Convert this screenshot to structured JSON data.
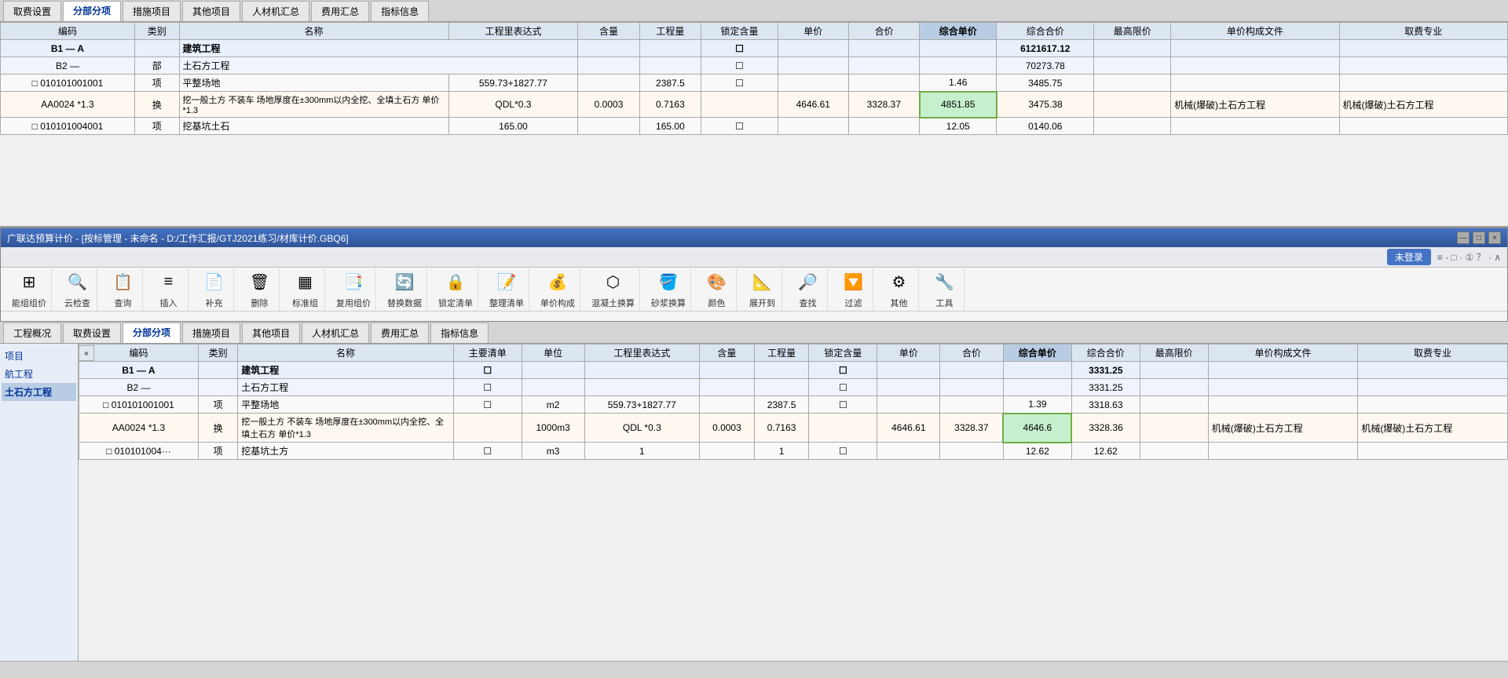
{
  "topWindow": {
    "tabs": [
      {
        "label": "取费设置",
        "active": false
      },
      {
        "label": "分部分项",
        "active": true
      },
      {
        "label": "措施项目",
        "active": false
      },
      {
        "label": "其他项目",
        "active": false
      },
      {
        "label": "人材机汇总",
        "active": false
      },
      {
        "label": "费用汇总",
        "active": false
      },
      {
        "label": "指标信息",
        "active": false
      }
    ],
    "columns": [
      {
        "label": "编码"
      },
      {
        "label": "类别"
      },
      {
        "label": "名称"
      },
      {
        "label": "工程里表达式"
      },
      {
        "label": "含量"
      },
      {
        "label": "工程量"
      },
      {
        "label": "锁定含量"
      },
      {
        "label": "单价"
      },
      {
        "label": "合价"
      },
      {
        "label": "综合单价"
      },
      {
        "label": "综合合价"
      },
      {
        "label": "最高限价"
      },
      {
        "label": "单价构成文件"
      },
      {
        "label": "取费专业"
      }
    ],
    "rows": [
      {
        "id": "B1",
        "type": "",
        "code": "A",
        "name": "建筑工程",
        "expr": "",
        "hl": "",
        "qty": "",
        "lock": "",
        "dj": "",
        "hj": "",
        "zhDj": "",
        "zhHj": "6121617.12",
        "max": "",
        "file": "",
        "fee": "",
        "isB1": true
      },
      {
        "id": "B2",
        "type": "部",
        "code": "",
        "name": "土石方工程",
        "expr": "",
        "hl": "",
        "qty": "",
        "lock": "",
        "dj": "",
        "hj": "",
        "zhDj": "",
        "zhHj": "70273.78",
        "max": "",
        "file": "",
        "fee": "",
        "isB2": true
      },
      {
        "id": "1",
        "type": "项",
        "code": "010101001001",
        "name": "平整场地",
        "expr": "559.73+1827.77",
        "hl": "",
        "qty": "2387.5",
        "lock": "",
        "dj": "",
        "hj": "",
        "zhDj": "1.46",
        "zhHj": "3485.75",
        "max": "",
        "file": "",
        "fee": ""
      },
      {
        "id": "aa",
        "type": "换",
        "code": "AA0024 *1.3",
        "name": "挖一般土方 不装车 场地厚度在±300mm以内全挖、全填土石方 单价*1.3",
        "expr": "QDL*0.3",
        "hl": "0.0003",
        "qty": "0.7163",
        "lock": "",
        "dj": "4646.61",
        "hj": "3328.37",
        "zhDj": "4851.85",
        "zhHj": "3475.38",
        "max": "",
        "file": "机械(爆破)土石方工程",
        "fee": "机械(爆破)土石方工程",
        "isAA": true
      },
      {
        "id": "next",
        "type": "项",
        "code": "010101004001",
        "name": "挖基坑土石",
        "expr": "165.00",
        "hl": "",
        "qty": "165.00",
        "lock": "",
        "dj": "",
        "hj": "",
        "zhDj": "12.05",
        "zhHj": "0140.06",
        "max": "",
        "file": "",
        "fee": ""
      }
    ]
  },
  "titleBar": {
    "text": "广联达预算计价 - [按标管理 - 未命名 - D:/工作汇报/GTJ2021练习/材库计价.GBQ6]",
    "buttons": [
      "—",
      "□",
      "×"
    ]
  },
  "middleToolbar": {
    "loginBtn": "未登录",
    "groups": [
      {
        "icon": "⊞",
        "label": "能组组价"
      },
      {
        "icon": "🔍",
        "label": "云检查"
      },
      {
        "icon": "📋",
        "label": "查询"
      },
      {
        "icon": "≡",
        "label": "插入"
      },
      {
        "icon": "📄",
        "label": "补充"
      },
      {
        "icon": "🗑",
        "label": "删除"
      },
      {
        "icon": "▦",
        "label": "标准组"
      },
      {
        "icon": "📑",
        "label": "复用组价"
      },
      {
        "icon": "🔄",
        "label": "替换数据"
      },
      {
        "icon": "🔒",
        "label": "锁定清单"
      },
      {
        "icon": "📝",
        "label": "整理清单"
      },
      {
        "icon": "💰",
        "label": "单价构成"
      },
      {
        "icon": "⬡",
        "label": "混凝土换算"
      },
      {
        "icon": "🪣",
        "label": "砂浆换算"
      },
      {
        "icon": "🎨",
        "label": "颜色"
      },
      {
        "icon": "📐",
        "label": "展开到"
      },
      {
        "icon": "🔎",
        "label": "查找"
      },
      {
        "icon": "🔽",
        "label": "过滤"
      },
      {
        "icon": "⚙",
        "label": "其他"
      },
      {
        "icon": "🔧",
        "label": "工具"
      }
    ]
  },
  "bottomWindow": {
    "tabs": [
      {
        "label": "工程概况",
        "active": false
      },
      {
        "label": "取费设置",
        "active": false
      },
      {
        "label": "分部分项",
        "active": true
      },
      {
        "label": "措施项目",
        "active": false
      },
      {
        "label": "其他项目",
        "active": false
      },
      {
        "label": "人材机汇总",
        "active": false
      },
      {
        "label": "费用汇总",
        "active": false
      },
      {
        "label": "指标信息",
        "active": false
      }
    ],
    "sidebar": [
      {
        "label": "项目",
        "active": false
      },
      {
        "label": "航工程",
        "active": false
      },
      {
        "label": "土石方工程",
        "active": true
      }
    ],
    "cornerBtn": "«",
    "columns": [
      {
        "label": "编码"
      },
      {
        "label": "类别"
      },
      {
        "label": "名称"
      },
      {
        "label": "主要清单"
      },
      {
        "label": "单位"
      },
      {
        "label": "工程里表达式"
      },
      {
        "label": "含量"
      },
      {
        "label": "工程量"
      },
      {
        "label": "锁定含量"
      },
      {
        "label": "单价"
      },
      {
        "label": "合价"
      },
      {
        "label": "综合单价"
      },
      {
        "label": "综合合价"
      },
      {
        "label": "最高限价"
      },
      {
        "label": "单价构成文件"
      },
      {
        "label": "取费专业"
      }
    ],
    "rows": [
      {
        "id": "B1",
        "code": "A",
        "type": "",
        "name": "建筑工程",
        "zyd": "",
        "unit": "",
        "expr": "",
        "hl": "",
        "qty": "",
        "lock": "",
        "dj": "",
        "hj": "",
        "zhDj": "",
        "zhHj": "3331.25",
        "max": "",
        "file": "",
        "fee": "",
        "isB1": true
      },
      {
        "id": "B2",
        "code": "",
        "type": "",
        "name": "土石方工程",
        "zyd": "",
        "unit": "",
        "expr": "",
        "hl": "",
        "qty": "",
        "lock": "",
        "dj": "",
        "hj": "",
        "zhDj": "",
        "zhHj": "3331.25",
        "max": "",
        "file": "",
        "fee": "",
        "isB2": true
      },
      {
        "id": "1",
        "code": "010101001001",
        "type": "项",
        "name": "平整场地",
        "zyd": "",
        "unit": "m2",
        "expr": "559.73+1827.77",
        "hl": "",
        "qty": "2387.5",
        "lock": "",
        "dj": "",
        "hj": "",
        "zhDj": "1.39",
        "zhHj": "3318.63",
        "max": "",
        "file": "",
        "fee": ""
      },
      {
        "id": "aa",
        "code": "AA0024 *1.3",
        "type": "换",
        "name": "挖一般土方 不装车 场地厚度在±300mm以内全挖、全填土石方 单价*1.3",
        "zyd": "",
        "unit": "1000m3",
        "expr": "QDL *0.3",
        "hl": "0.0003",
        "qty": "0.7163",
        "lock": "",
        "dj": "4646.61",
        "hj": "3328.37",
        "zhDj": "4646.6",
        "zhHj": "3328.36",
        "max": "",
        "file": "机械(爆破)土石方工程",
        "fee": "机械(爆破)土石方工程",
        "isAA": true
      },
      {
        "id": "2",
        "code": "010101004···",
        "type": "项",
        "name": "挖基坑土方",
        "zyd": "",
        "unit": "m3",
        "expr": "1",
        "hl": "",
        "qty": "1",
        "lock": "",
        "dj": "",
        "hj": "",
        "zhDj": "12.62",
        "zhHj": "12.62",
        "max": "",
        "file": "",
        "fee": ""
      }
    ]
  }
}
